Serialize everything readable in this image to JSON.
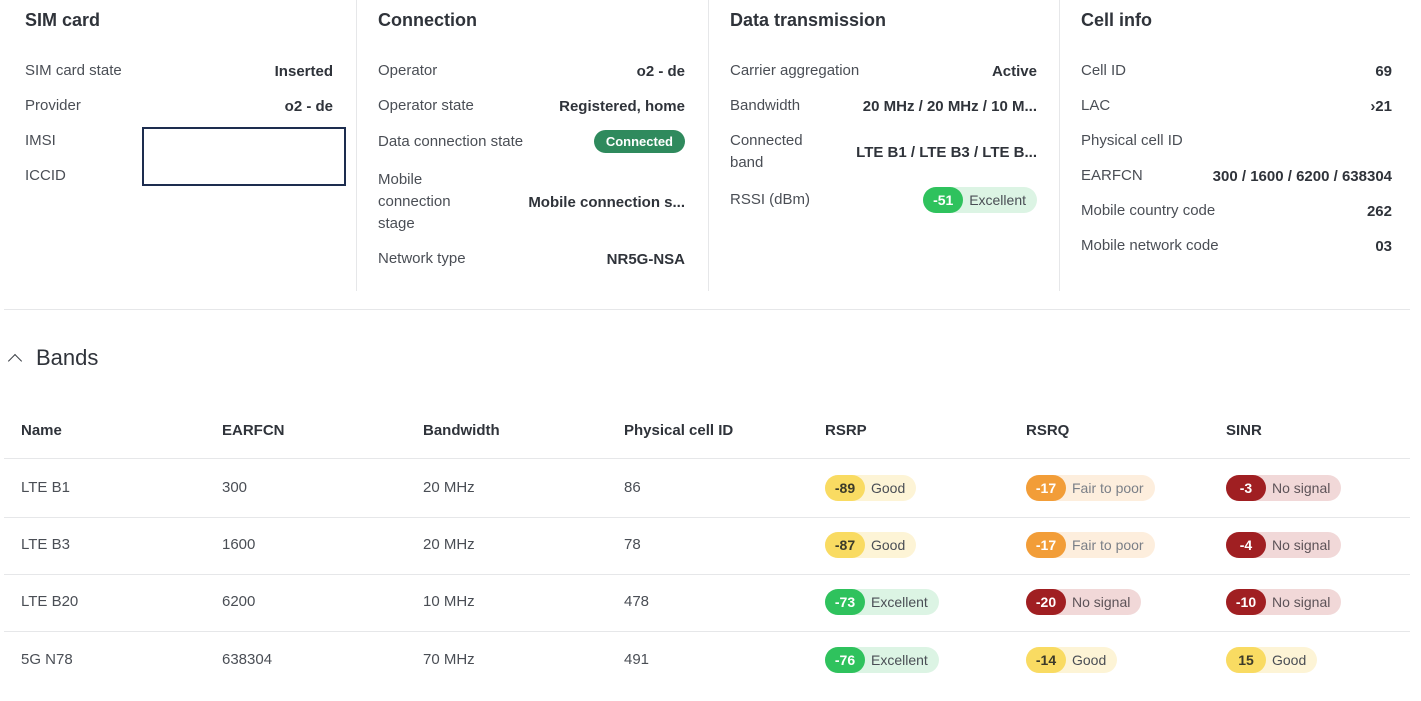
{
  "sim_card": {
    "title": "SIM card",
    "rows": [
      {
        "label": "SIM card state",
        "value": "Inserted"
      },
      {
        "label": "Provider",
        "value": "o2 - de"
      },
      {
        "label": "IMSI",
        "value": ""
      },
      {
        "label": "ICCID",
        "value": ""
      }
    ]
  },
  "connection": {
    "title": "Connection",
    "operator": {
      "label": "Operator",
      "value": "o2 - de"
    },
    "operator_state": {
      "label": "Operator state",
      "value": "Registered, home"
    },
    "data_state": {
      "label": "Data connection state",
      "value": "Connected"
    },
    "stage": {
      "label_line1": "Mobile",
      "label_line2": "connection",
      "label_line3": "stage",
      "value": "Mobile connection s..."
    },
    "network_type": {
      "label": "Network type",
      "value": "NR5G-NSA"
    }
  },
  "data_transmission": {
    "title": "Data transmission",
    "carrier_aggregation": {
      "label": "Carrier aggregation",
      "value": "Active"
    },
    "bandwidth": {
      "label": "Bandwidth",
      "value": "20 MHz / 20 MHz / 10 M..."
    },
    "connected_band": {
      "label_line1": "Connected",
      "label_line2": "band",
      "value": "LTE B1 / LTE B3 / LTE B..."
    },
    "rssi": {
      "label": "RSSI (dBm)",
      "value": "-51",
      "quality": "Excellent"
    }
  },
  "cell_info": {
    "title": "Cell info",
    "rows": [
      {
        "label": "Cell ID",
        "value": "69"
      },
      {
        "label": "LAC",
        "value": "›21"
      },
      {
        "label": "Physical cell ID",
        "value": ""
      },
      {
        "label": "EARFCN",
        "value": "300 / 1600 / 6200 / 638304"
      },
      {
        "label": "Mobile country code",
        "value": "262"
      },
      {
        "label": "Mobile network code",
        "value": "03"
      }
    ]
  },
  "bands": {
    "title": "Bands",
    "columns": [
      "Name",
      "EARFCN",
      "Bandwidth",
      "Physical cell ID",
      "RSRP",
      "RSRQ",
      "SINR"
    ],
    "rows": [
      {
        "name": "LTE B1",
        "earfcn": "300",
        "bandwidth": "20 MHz",
        "pci": "86",
        "rsrp": {
          "value": "-89",
          "quality": "Good"
        },
        "rsrq": {
          "value": "-17",
          "quality": "Fair to poor"
        },
        "sinr": {
          "value": "-3",
          "quality": "No signal"
        }
      },
      {
        "name": "LTE B3",
        "earfcn": "1600",
        "bandwidth": "20 MHz",
        "pci": "78",
        "rsrp": {
          "value": "-87",
          "quality": "Good"
        },
        "rsrq": {
          "value": "-17",
          "quality": "Fair to poor"
        },
        "sinr": {
          "value": "-4",
          "quality": "No signal"
        }
      },
      {
        "name": "LTE B20",
        "earfcn": "6200",
        "bandwidth": "10 MHz",
        "pci": "478",
        "rsrp": {
          "value": "-73",
          "quality": "Excellent"
        },
        "rsrq": {
          "value": "-20",
          "quality": "No signal"
        },
        "sinr": {
          "value": "-10",
          "quality": "No signal"
        }
      },
      {
        "name": "5G N78",
        "earfcn": "638304",
        "bandwidth": "70 MHz",
        "pci": "491",
        "rsrp": {
          "value": "-76",
          "quality": "Excellent"
        },
        "rsrq": {
          "value": "-14",
          "quality": "Good"
        },
        "sinr": {
          "value": "15",
          "quality": "Good"
        }
      }
    ]
  },
  "colors": {
    "excellent": "#2fc25d",
    "good": "#f9db62",
    "fair_to_poor": "#f29d38",
    "no_signal": "#a01f22",
    "connected_pill": "#2f8a5d"
  }
}
